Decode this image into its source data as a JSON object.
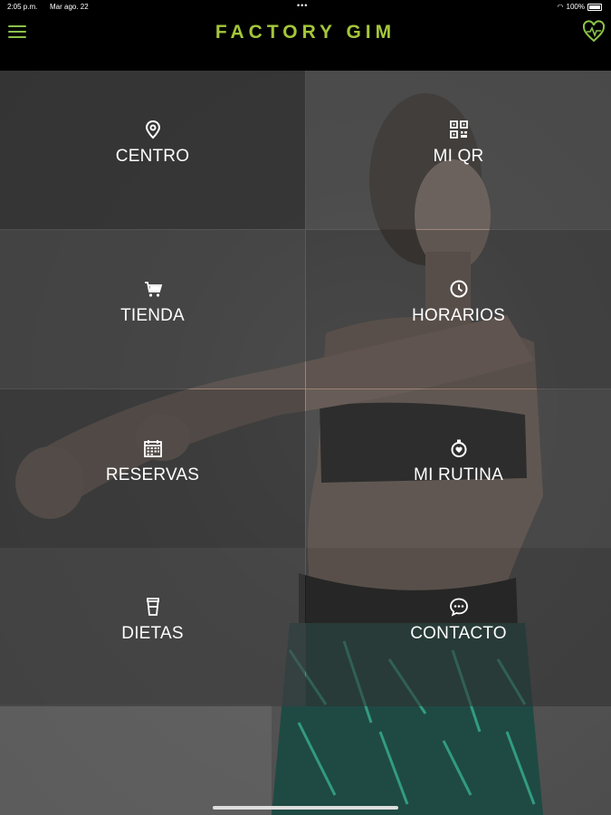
{
  "status_bar": {
    "time": "2:05 p.m.",
    "date": "Mar ago. 22",
    "dots": "•••",
    "battery_text": "100%"
  },
  "app": {
    "title": "FACTORY GIM",
    "accent_color": "#a4c639",
    "menu_icon": "hamburger-menu-icon",
    "heart_icon": "heart-pulse-icon"
  },
  "menu": {
    "items": [
      {
        "label": "CENTRO",
        "icon": "map-pin-icon"
      },
      {
        "label": "MI QR",
        "icon": "qr-code-icon"
      },
      {
        "label": "TIENDA",
        "icon": "shopping-cart-icon"
      },
      {
        "label": "HORARIOS",
        "icon": "clock-icon"
      },
      {
        "label": "RESERVAS",
        "icon": "calendar-icon"
      },
      {
        "label": "MI RUTINA",
        "icon": "stopwatch-heart-icon"
      },
      {
        "label": "DIETAS",
        "icon": "drink-cup-icon"
      },
      {
        "label": "CONTACTO",
        "icon": "chat-bubble-icon"
      }
    ]
  }
}
